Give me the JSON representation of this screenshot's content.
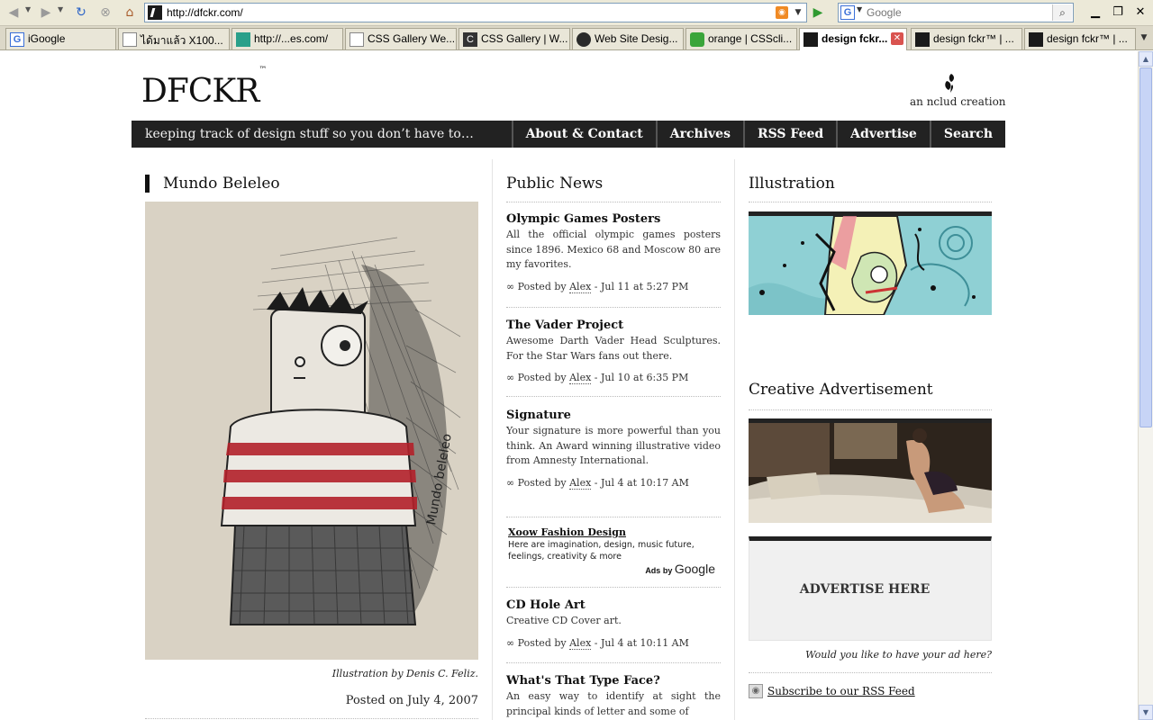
{
  "browser": {
    "url": "http://dfckr.com/",
    "search_placeholder": "Google",
    "tabs": [
      {
        "label": "iGoogle",
        "icon": "google-icon"
      },
      {
        "label": "ได้มาแล้ว X100...",
        "icon": "page-icon"
      },
      {
        "label": "http://...es.com/",
        "icon": "house-icon"
      },
      {
        "label": "CSS Gallery We...",
        "icon": "page-icon"
      },
      {
        "label": "CSS Gallery | W...",
        "icon": "cssgallery-icon"
      },
      {
        "label": "Web Site Desig...",
        "icon": "web-icon"
      },
      {
        "label": "orange | CSScli...",
        "icon": "leaf-icon"
      },
      {
        "label": "design fckr...",
        "icon": "dfckr-icon",
        "active": true
      },
      {
        "label": "design fckr™ | ...",
        "icon": "dfckr-icon"
      },
      {
        "label": "design fckr™ | ...",
        "icon": "dfckr-icon"
      }
    ]
  },
  "site": {
    "logo": "DFCKR",
    "logo_tm": "™",
    "byline": "an nclud creation",
    "tagline": "keeping track of design stuff so you don’t have to…",
    "menu": [
      "About & Contact",
      "Archives",
      "RSS Feed",
      "Advertise",
      "Search"
    ]
  },
  "feature": {
    "title": "Mundo Beleleo",
    "caption": "Illustration by Denis C. Feliz.",
    "posted": "Posted on July 4, 2007",
    "signature": "Mundo beleleo"
  },
  "news": {
    "title": "Public News",
    "items": [
      {
        "title": "Olympic Games Posters",
        "body": "All the official olympic games posters since 1896. Mexico 68 and Moscow 80 are my favorites.",
        "prefix": "∞ Posted by",
        "author": "Alex",
        "date": "- Jul 11 at 5:27 PM"
      },
      {
        "title": "The Vader Project",
        "body": "Awesome Darth Vader Head Sculptures. For the Star Wars fans out there.",
        "prefix": "∞ Posted by",
        "author": "Alex",
        "date": "- Jul 10 at 6:35 PM"
      },
      {
        "title": "Signature",
        "body": "Your signature is more powerful than you think. An Award winning illustrative video from Amnesty International.",
        "prefix": "∞ Posted by",
        "author": "Alex",
        "date": "- Jul 4 at 10:17 AM"
      },
      {
        "title": "CD Hole Art",
        "body": "Creative CD Cover art.",
        "prefix": "∞ Posted by",
        "author": "Alex",
        "date": "- Jul 4 at 10:11 AM"
      },
      {
        "title": "What's That Type Face?",
        "body": "An easy way to identify at sight the principal kinds of letter and some of"
      }
    ],
    "ad": {
      "title": "Xoow Fashion Design",
      "body": "Here are imagination, design, music future, feelings, creativity & more",
      "by": "Ads by",
      "brand": "Google"
    }
  },
  "sidebar": {
    "illustration_title": "Illustration",
    "advert_title": "Creative Advertisement",
    "ad_label": "ADVERTISE HERE",
    "ad_question": "Would you like to have your ad here?",
    "subscribe": "Subscribe to our RSS Feed"
  }
}
